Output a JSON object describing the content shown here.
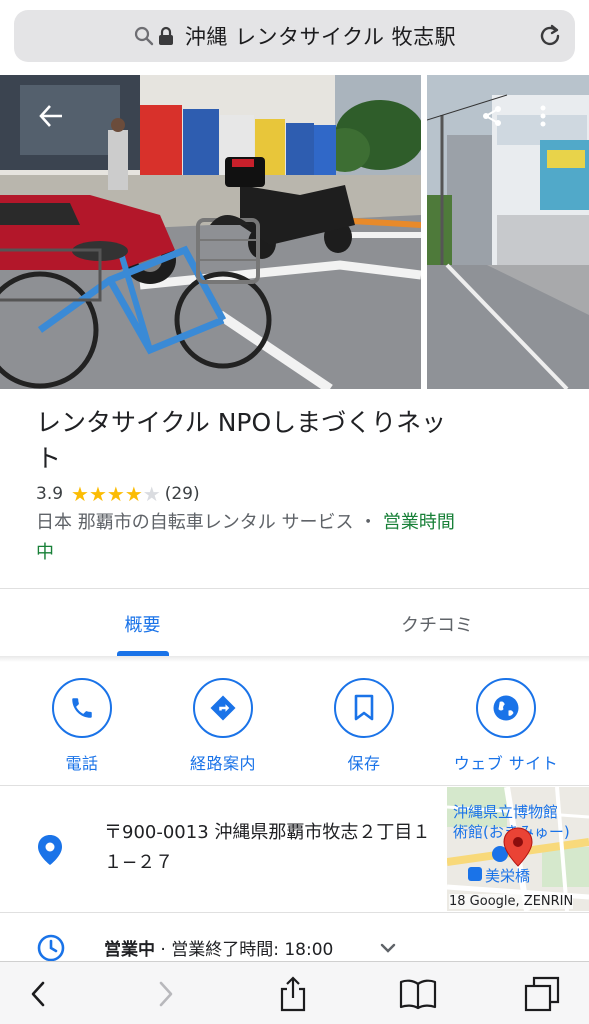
{
  "url_bar": {
    "text": "沖縄 レンタサイクル 牧志駅",
    "icons": [
      "search-icon",
      "lock-icon",
      "reload-icon"
    ]
  },
  "photos": {
    "icons": [
      "back-arrow-icon",
      "share-icon",
      "more-vert-icon"
    ]
  },
  "place": {
    "name": "レンタサイクル NPOしまづくりネット",
    "rating": "3.9",
    "stars_value": 3.9,
    "review_count": "(29)",
    "category": "日本 那覇市の自転車レンタル サービス ・ ",
    "open_status": "営業時間中"
  },
  "tabs": [
    {
      "label": "概要",
      "active": true
    },
    {
      "label": "クチコミ",
      "active": false
    }
  ],
  "actions": [
    {
      "label": "電話",
      "icon": "phone-icon"
    },
    {
      "label": "経路案内",
      "icon": "directions-icon"
    },
    {
      "label": "保存",
      "icon": "bookmark-icon"
    },
    {
      "label": "ウェブ サイト",
      "icon": "globe-icon"
    }
  ],
  "address": {
    "text": "〒900-0013 沖縄県那覇市牧志２丁目１１−２７",
    "icon": "location-pin-icon"
  },
  "map": {
    "label1": "沖縄県立博物館",
    "label2": "術館(おきみゅー)",
    "station": "美栄橋",
    "credit": "18 Google, ZENRIN"
  },
  "hours": {
    "status": "営業中",
    "separator": " · ",
    "closing": "営業終了時間: 18:00",
    "icon": "clock-icon"
  },
  "toolbar": {
    "icons": [
      "back-icon",
      "forward-icon",
      "share-icon",
      "bookmarks-icon",
      "tabs-icon"
    ]
  },
  "colors": {
    "accent": "#1a73e8",
    "open_green": "#188038",
    "star_yellow": "#fbbc04",
    "pin_red": "#ea4335"
  }
}
